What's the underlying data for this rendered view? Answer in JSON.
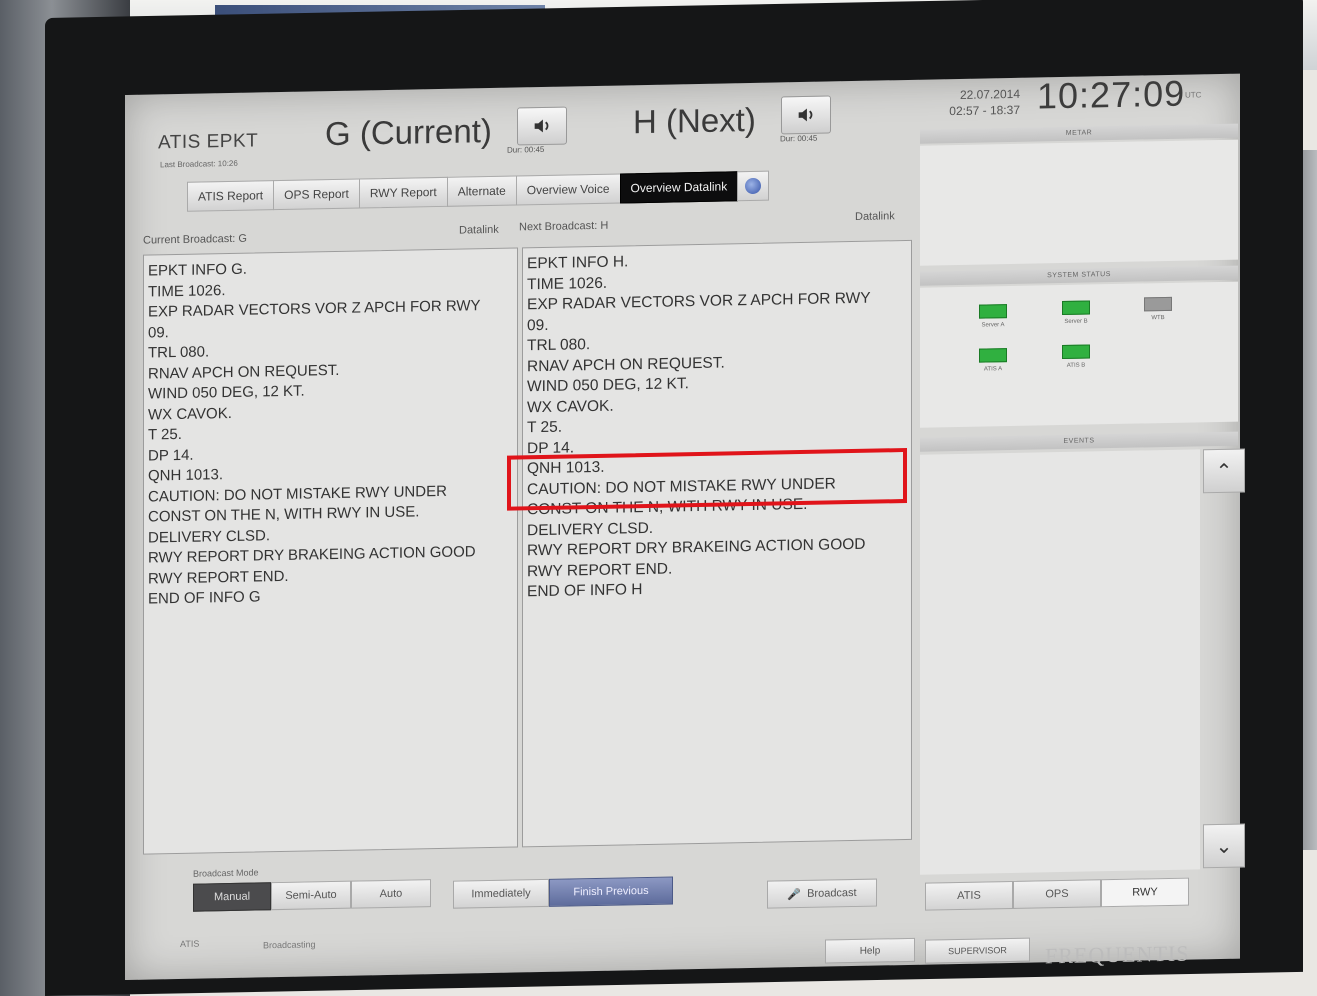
{
  "header": {
    "atis_id": "ATIS EPKT",
    "last_broadcast": "Last Broadcast: 10:26",
    "current_title": "G (Current)",
    "current_duration": "Dur: 00:45",
    "next_title": "H (Next)",
    "next_duration": "Dur: 00:45",
    "date": "22.07.2014",
    "time_range": "02:57 - 18:37",
    "clock": "10:27:09",
    "clock_unit": "UTC"
  },
  "tabs": [
    {
      "label": "ATIS Report"
    },
    {
      "label": "OPS Report"
    },
    {
      "label": "RWY Report"
    },
    {
      "label": "Alternate"
    },
    {
      "label": "Overview Voice"
    },
    {
      "label": "Overview Datalink",
      "active": true
    }
  ],
  "panels": {
    "current_label": "Current Broadcast:  G",
    "datalink_left": "Datalink",
    "next_label": "Next Broadcast:   H",
    "datalink_right": "Datalink",
    "current_lines": [
      "EPKT INFO G.",
      "TIME 1026.",
      "EXP RADAR VECTORS VOR Z APCH FOR RWY",
      "09.",
      "TRL 080.",
      "RNAV APCH ON REQUEST.",
      "WIND 050 DEG, 12 KT.",
      "WX CAVOK.",
      "T 25.",
      "DP 14.",
      "QNH 1013.",
      "CAUTION: DO NOT MISTAKE RWY UNDER",
      "CONST ON THE N, WITH RWY IN USE.",
      "DELIVERY CLSD.",
      "RWY REPORT DRY BRAKEING ACTION GOOD",
      "RWY REPORT END.",
      "END OF INFO G"
    ],
    "next_lines": [
      "EPKT INFO H.",
      "TIME 1026.",
      "EXP RADAR VECTORS VOR Z APCH FOR RWY",
      "09.",
      "TRL 080.",
      "RNAV APCH ON REQUEST.",
      "WIND 050 DEG, 12 KT.",
      "WX CAVOK.",
      "T 25.",
      "DP 14.",
      "QNH 1013.",
      "CAUTION: DO NOT MISTAKE RWY UNDER",
      "CONST ON THE N, WITH RWY IN USE.",
      "DELIVERY CLSD.",
      "RWY REPORT DRY BRAKEING ACTION GOOD",
      "RWY REPORT END.",
      "END OF INFO H"
    ]
  },
  "right": {
    "metar_title": "METAR",
    "system_status_title": "SYSTEM STATUS",
    "status": [
      {
        "label": "Server A",
        "state": "ok"
      },
      {
        "label": "Server B",
        "state": "ok"
      },
      {
        "label": "WTB",
        "state": "off"
      },
      {
        "label": "ATIS A",
        "state": "ok"
      },
      {
        "label": "ATIS B",
        "state": "ok"
      }
    ],
    "events_title": "EVENTS"
  },
  "bottom": {
    "broadcast_mode_label": "Broadcast Mode",
    "mode_buttons": [
      "Manual",
      "Semi-Auto",
      "Auto"
    ],
    "immediately": "Immediately",
    "finish_previous": "Finish Previous",
    "broadcast": "Broadcast",
    "freq_buttons": [
      "ATIS",
      "OPS",
      "RWY"
    ],
    "footer_left_1": "ATIS",
    "footer_left_2": "Broadcasting",
    "help": "Help",
    "supervisor": "SUPERVISOR",
    "brand": "FREQUENTIS"
  },
  "colors": {
    "highlight": "#e0141a",
    "status_ok": "#30b040",
    "active_tab": "#0d0d0e"
  }
}
